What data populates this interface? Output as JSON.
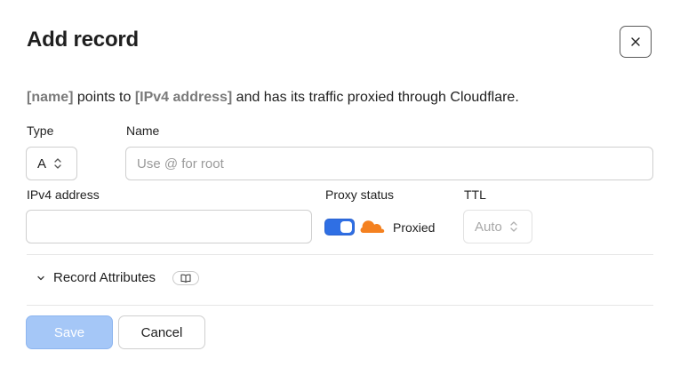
{
  "dialog": {
    "title": "Add record",
    "close_label": "Close"
  },
  "description": {
    "name_placeholder": "[name]",
    "points_to": " points to ",
    "ipv4_placeholder": "[IPv4 address]",
    "suffix": " and has its traffic proxied through Cloudflare."
  },
  "type_field": {
    "label": "Type",
    "value": "A"
  },
  "name_field": {
    "label": "Name",
    "placeholder": "Use @ for root",
    "value": ""
  },
  "ipv4_field": {
    "label": "IPv4 address",
    "value": ""
  },
  "proxy": {
    "label": "Proxy status",
    "enabled": true,
    "status_text": "Proxied"
  },
  "ttl": {
    "label": "TTL",
    "value": "Auto"
  },
  "record_attributes": {
    "label": "Record Attributes"
  },
  "buttons": {
    "save": "Save",
    "cancel": "Cancel"
  },
  "colors": {
    "accent": "#2f6fe4",
    "save_disabled": "#a5c7f7",
    "cloud": "#f48120"
  }
}
